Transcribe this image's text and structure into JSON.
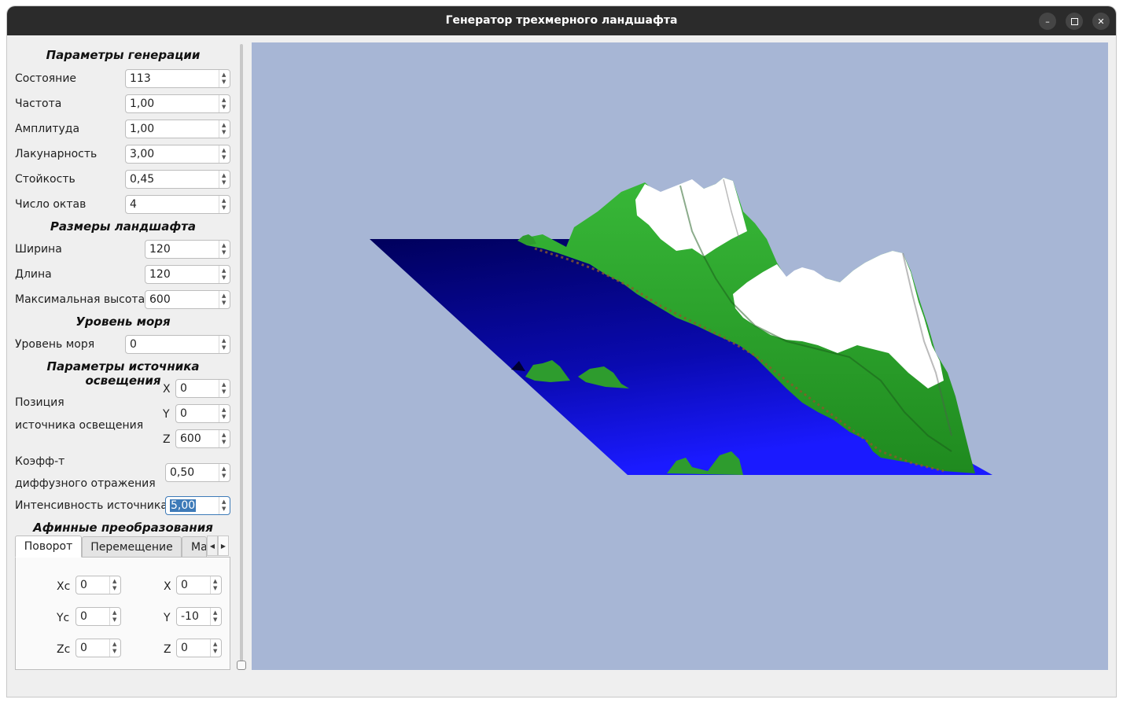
{
  "window": {
    "title": "Генератор трехмерного ландшафта",
    "minimize_icon": "minimize-icon",
    "maximize_icon": "maximize-icon",
    "close_icon": "close-icon"
  },
  "generation": {
    "header": "Параметры генерации",
    "state_label": "Состояние",
    "state_value": "113",
    "frequency_label": "Частота",
    "frequency_value": "1,00",
    "amplitude_label": "Амплитуда",
    "amplitude_value": "1,00",
    "lacunarity_label": "Лакунарность",
    "lacunarity_value": "3,00",
    "persistence_label": "Стойкость",
    "persistence_value": "0,45",
    "octaves_label": "Число октав",
    "octaves_value": "4"
  },
  "size": {
    "header": "Размеры ландшафта",
    "width_label": "Ширина",
    "width_value": "120",
    "length_label": "Длина",
    "length_value": "120",
    "max_height_label": "Максимальная высота",
    "max_height_value": "600"
  },
  "sea": {
    "header": "Уровень моря",
    "level_label": "Уровень моря",
    "level_value": "0"
  },
  "light": {
    "header": "Параметры источника освещения",
    "position_label_line1": "Позиция",
    "position_label_line2": "источника освещения",
    "x_label": "X",
    "x_value": "0",
    "y_label": "Y",
    "y_value": "0",
    "z_label": "Z",
    "z_value": "600",
    "diffuse_label_line1": "Коэфф-т",
    "diffuse_label_line2": "диффузного отражения",
    "diffuse_value": "0,50",
    "intensity_label": "Интенсивность источника",
    "intensity_value": "5,00"
  },
  "affine": {
    "header": "Афинные преобразования",
    "tabs": [
      "Поворот",
      "Перемещение",
      "Ма"
    ],
    "xc_label": "Xc",
    "xc_value": "0",
    "yc_label": "Yc",
    "yc_value": "0",
    "zc_label": "Zc",
    "zc_value": "0",
    "x_label": "X",
    "x_value": "0",
    "y_label": "Y",
    "y_value": "-10",
    "z_label": "Z",
    "z_value": "0"
  },
  "colors": {
    "background": "#a7b6d5",
    "water_dark": "#000066",
    "water_light": "#1a1aff",
    "grass": "#2da82d",
    "snow": "#ffffff",
    "soil": "#8a5a2a"
  }
}
